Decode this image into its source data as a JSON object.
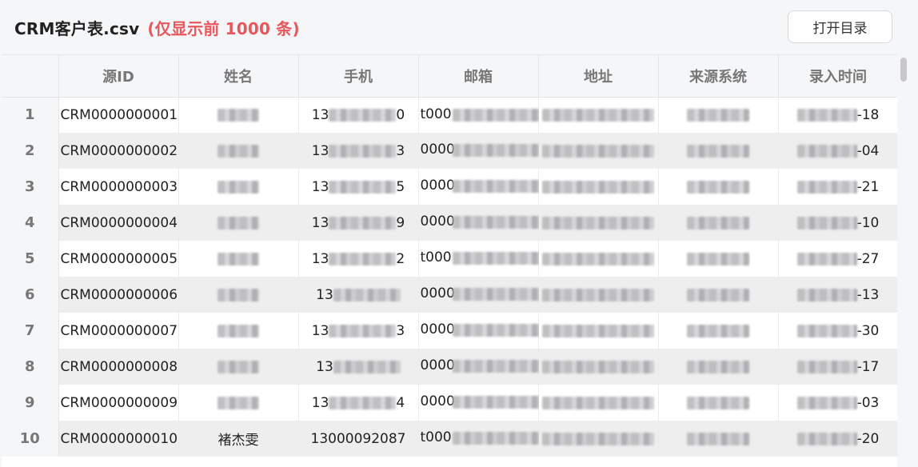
{
  "header": {
    "filename": "CRM客户表.csv",
    "limit_note": "(仅显示前 1000 条)",
    "open_dir_label": "打开目录"
  },
  "table": {
    "columns": [
      "源ID",
      "姓名",
      "手机",
      "邮箱",
      "地址",
      "来源系统",
      "录入时间"
    ],
    "rows": [
      {
        "index": "1",
        "id": "CRM0000000001",
        "name": "",
        "phone_prefix": "13",
        "phone_suffix": "0",
        "email_prefix": "t000",
        "date_suffix": "-18"
      },
      {
        "index": "2",
        "id": "CRM0000000002",
        "name": "",
        "phone_prefix": "13",
        "phone_suffix": "3",
        "email_prefix": "0000",
        "date_suffix": "-04"
      },
      {
        "index": "3",
        "id": "CRM0000000003",
        "name": "",
        "phone_prefix": "13",
        "phone_suffix": "5",
        "email_prefix": "0000",
        "date_suffix": "-21"
      },
      {
        "index": "4",
        "id": "CRM0000000004",
        "name": "",
        "phone_prefix": "13",
        "phone_suffix": "9",
        "email_prefix": "0000",
        "date_suffix": "-10"
      },
      {
        "index": "5",
        "id": "CRM0000000005",
        "name": "",
        "phone_prefix": "13",
        "phone_suffix": "2",
        "email_prefix": "t000",
        "date_suffix": "-27"
      },
      {
        "index": "6",
        "id": "CRM0000000006",
        "name": "",
        "phone_prefix": "13",
        "phone_suffix": "",
        "email_prefix": "0000",
        "date_suffix": "-13"
      },
      {
        "index": "7",
        "id": "CRM0000000007",
        "name": "",
        "phone_prefix": "13",
        "phone_suffix": "3",
        "email_prefix": "0000",
        "date_suffix": "-30"
      },
      {
        "index": "8",
        "id": "CRM0000000008",
        "name": "",
        "phone_prefix": "13",
        "phone_suffix": "",
        "email_prefix": "0000",
        "date_suffix": "-17"
      },
      {
        "index": "9",
        "id": "CRM0000000009",
        "name": "",
        "phone_prefix": "13",
        "phone_suffix": "4",
        "email_prefix": "0000",
        "date_suffix": "-03"
      },
      {
        "index": "10",
        "id": "CRM0000000010",
        "name": "褚杰雯",
        "phone": "13000092087",
        "phone_prefix": "13000092087",
        "phone_suffix": "",
        "email_prefix": "t000",
        "date_suffix": "-20"
      }
    ]
  },
  "colors": {
    "accent_red": "#e8575b",
    "header_bg": "#f5f6f8",
    "row_even_bg": "#eeeeee"
  }
}
